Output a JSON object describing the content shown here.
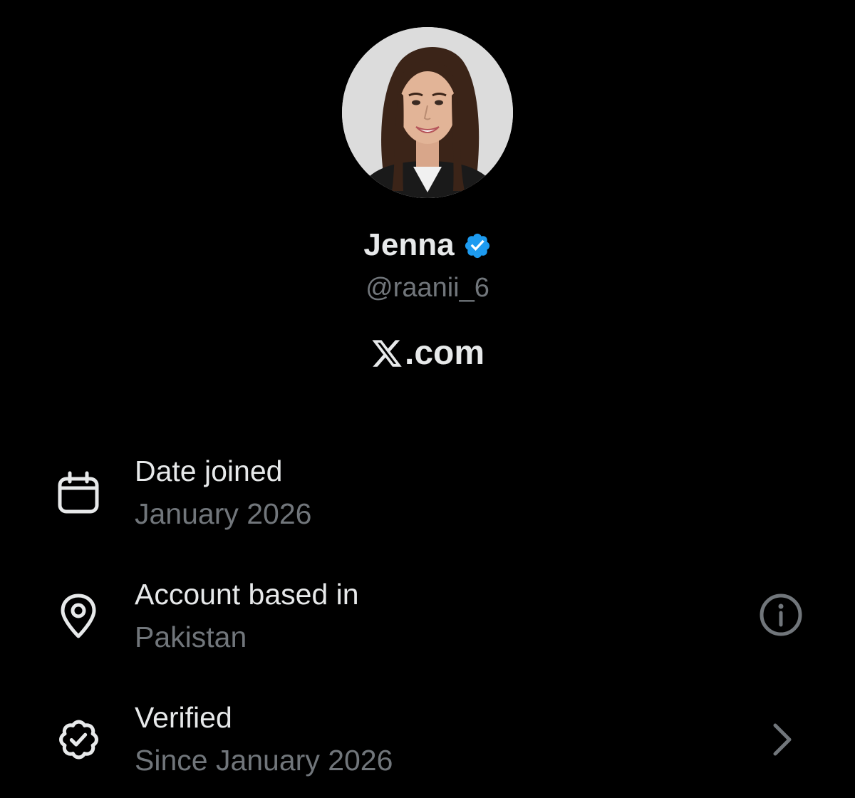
{
  "profile": {
    "name": "Jenna",
    "handle": "@raanii_6",
    "site": ".com",
    "avatar_icon": "profile-photo",
    "verified_badge_color": "#1d9bf0"
  },
  "details": [
    {
      "icon": "calendar-icon",
      "title": "Date joined",
      "value": "January 2026"
    },
    {
      "icon": "location-pin-icon",
      "title": "Account based in",
      "value": "Pakistan",
      "action_icon": "info-icon"
    },
    {
      "icon": "verified-check-icon",
      "title": "Verified",
      "value": "Since January 2026",
      "action_icon": "chevron-right-icon"
    }
  ],
  "colors": {
    "background": "#000000",
    "primary_text": "#e7e9ea",
    "secondary_text": "#71767b",
    "accent": "#1d9bf0"
  }
}
